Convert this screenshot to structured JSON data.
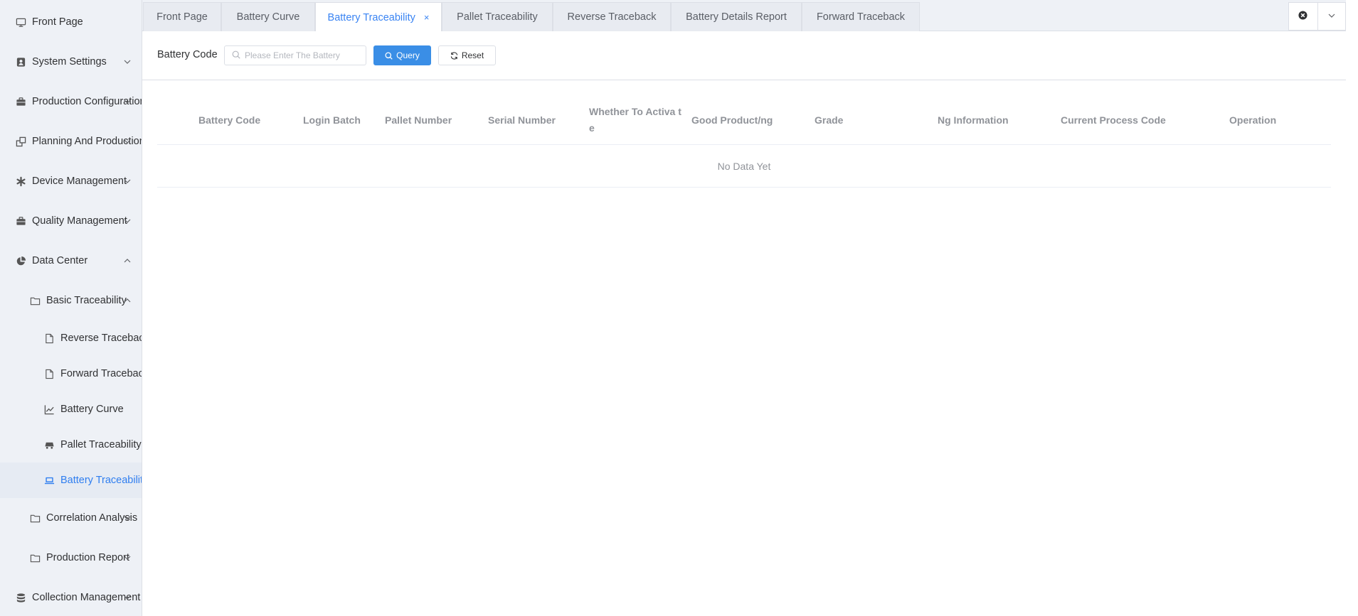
{
  "sidebar": {
    "items": [
      {
        "label": "Front Page",
        "icon": "monitor-icon"
      },
      {
        "label": "System Settings",
        "icon": "user-badge-icon"
      },
      {
        "label": "Production Configuration",
        "icon": "briefcase-icon"
      },
      {
        "label": "Planning And Production",
        "icon": "windows-icon"
      },
      {
        "label": "Device Management",
        "icon": "asterisk-icon"
      },
      {
        "label": "Quality Management",
        "icon": "briefcase-icon"
      },
      {
        "label": "Data Center",
        "icon": "pie-chart-icon"
      },
      {
        "label": "Basic Traceability",
        "icon": "folder-icon"
      },
      {
        "label": "Reverse Traceback",
        "icon": "document-icon"
      },
      {
        "label": "Forward Traceback",
        "icon": "document-icon"
      },
      {
        "label": "Battery Curve",
        "icon": "line-chart-icon"
      },
      {
        "label": "Pallet Traceability",
        "icon": "cart-icon"
      },
      {
        "label": "Battery Traceability",
        "icon": "laptop-icon"
      },
      {
        "label": "Correlation Analysis",
        "icon": "folder-icon"
      },
      {
        "label": "Production Report",
        "icon": "folder-icon"
      },
      {
        "label": "Collection Management",
        "icon": "database-icon"
      }
    ]
  },
  "tabs": [
    {
      "label": "Front Page"
    },
    {
      "label": "Battery Curve"
    },
    {
      "label": "Battery Traceability",
      "close": "×"
    },
    {
      "label": "Pallet Traceability"
    },
    {
      "label": "Reverse Traceback"
    },
    {
      "label": "Battery Details Report"
    },
    {
      "label": "Forward Traceback"
    }
  ],
  "search": {
    "label": "Battery Code",
    "placeholder": "Please Enter The Battery",
    "value": "",
    "query_label": "Query",
    "reset_label": "Reset"
  },
  "table": {
    "columns": [
      "Battery Code",
      "Login Batch",
      "Pallet Number",
      "Serial Number",
      "Whether To Activa te",
      "Good Product/ng",
      "Grade",
      "Ng Information",
      "Current Process Code",
      "Operation"
    ],
    "empty_text": "No Data Yet"
  },
  "colors": {
    "accent": "#3a8ee6",
    "active_text": "#2f7ef0",
    "sidebar_bg": "#eef1f6",
    "header_text": "#909399"
  }
}
